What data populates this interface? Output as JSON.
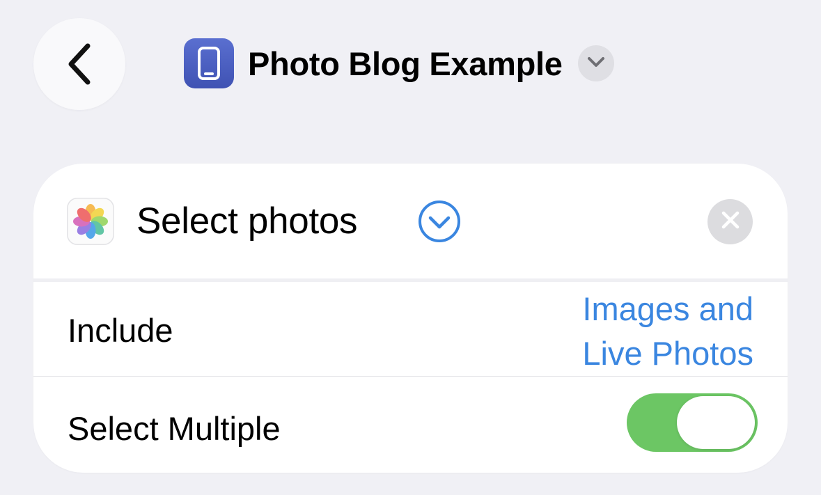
{
  "header": {
    "back_icon": "chevron-left-icon",
    "app_icon": "iphone-icon",
    "app_icon_color": "#4a5fc4",
    "title": "Photo Blog Example",
    "title_menu_icon": "chevron-down-icon"
  },
  "action": {
    "app_icon": "photos-app-icon",
    "title": "Select photos",
    "expand_icon": "chevron-down-circle-icon",
    "close_icon": "close-icon",
    "accent_color": "#3a86e0",
    "rows": {
      "include": {
        "label": "Include",
        "value": "Images and Live Photos"
      },
      "select_multiple": {
        "label": "Select Multiple",
        "toggle_on": true,
        "toggle_color": "#6cc664"
      }
    }
  }
}
